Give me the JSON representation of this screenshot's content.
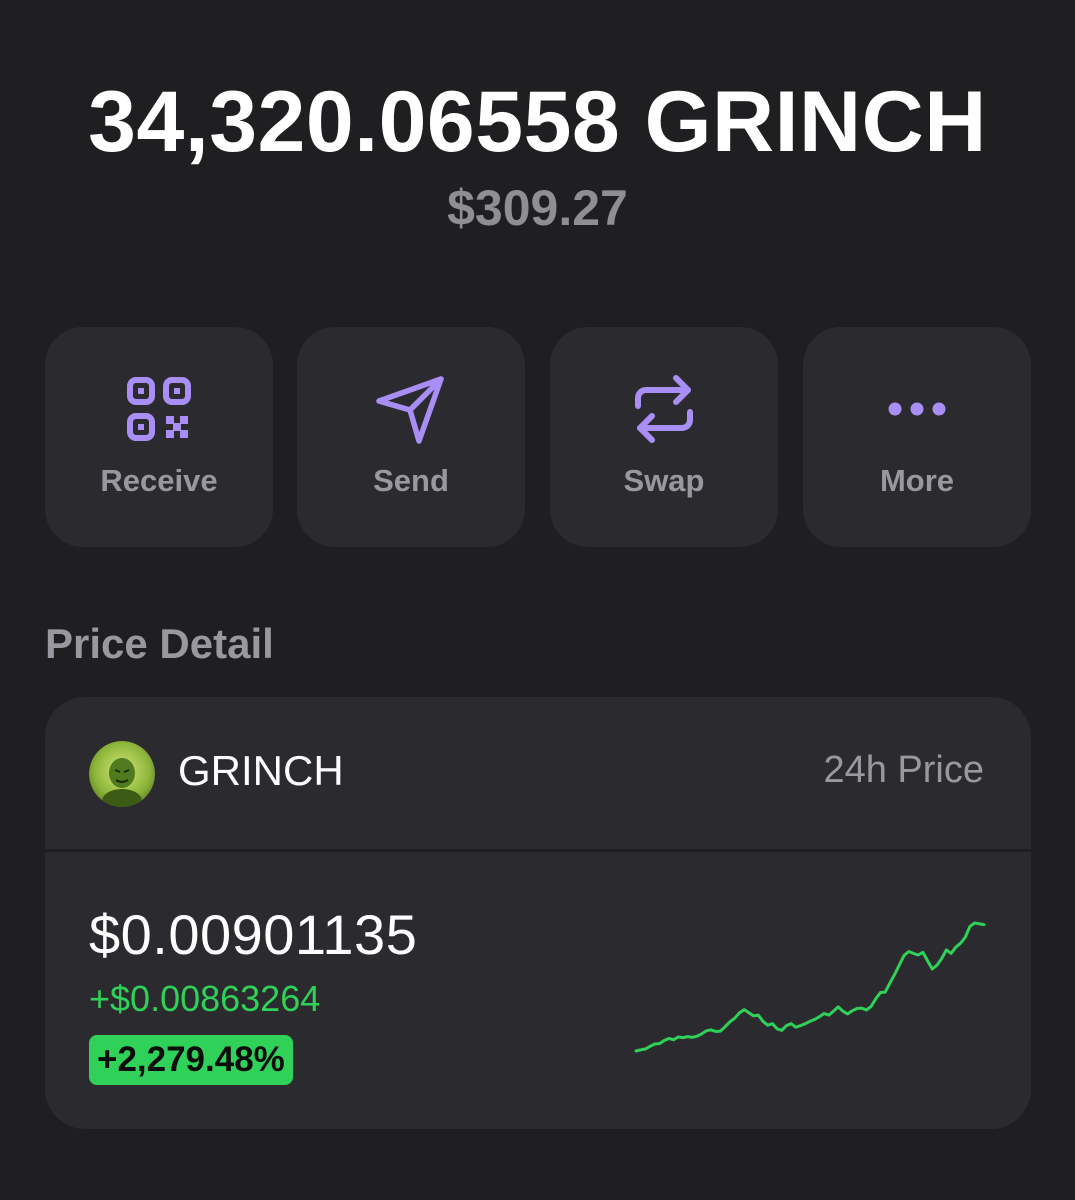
{
  "balance": {
    "amount": "34,320.06558 GRINCH",
    "fiat": "$309.27"
  },
  "actions": [
    {
      "label": "Receive",
      "icon": "qr-code-icon"
    },
    {
      "label": "Send",
      "icon": "send-arrow-icon"
    },
    {
      "label": "Swap",
      "icon": "swap-arrows-icon"
    },
    {
      "label": "More",
      "icon": "more-dots-icon"
    }
  ],
  "price_detail": {
    "section_title": "Price Detail",
    "token_name": "GRINCH",
    "period_label": "24h Price",
    "price": "$0.00901135",
    "change_abs": "+$0.00863264",
    "change_pct": "+2,279.48%"
  },
  "colors": {
    "background": "#1f1f21",
    "card": "#2b2b2f",
    "accent": "#a98ff5",
    "positive": "#30d158",
    "muted": "#98989f"
  },
  "chart_data": {
    "type": "line",
    "x": [
      0,
      1,
      2,
      3,
      4,
      5,
      6,
      7,
      8,
      9,
      10,
      11,
      12,
      13,
      14,
      15,
      16,
      17,
      18,
      19,
      20,
      21,
      22,
      23,
      24,
      25,
      26,
      27,
      28,
      29,
      30,
      31,
      32,
      33,
      34,
      35,
      36,
      37,
      38,
      39,
      40,
      41,
      42,
      43,
      44,
      45,
      46,
      47,
      48,
      49,
      50,
      51,
      52,
      53,
      54,
      55,
      56,
      57,
      58,
      59,
      60,
      61,
      62,
      63,
      64,
      65,
      66,
      67,
      68,
      69,
      70,
      71,
      72,
      73,
      74
    ],
    "values": [
      0.0,
      0.3,
      0.5,
      1.2,
      1.8,
      1.9,
      2.7,
      3.2,
      2.9,
      3.6,
      3.4,
      3.7,
      3.5,
      3.8,
      4.4,
      5.2,
      5.4,
      5.0,
      5.1,
      6.3,
      7.5,
      8.4,
      9.8,
      10.6,
      9.8,
      9.0,
      9.2,
      7.6,
      6.6,
      7.0,
      5.7,
      5.3,
      6.5,
      7.0,
      6.1,
      6.5,
      7.0,
      7.6,
      8.1,
      8.8,
      9.6,
      9.2,
      10.2,
      11.3,
      10.2,
      9.5,
      10.3,
      10.9,
      11.0,
      10.5,
      11.4,
      13.4,
      15.0,
      15.1,
      17.4,
      19.6,
      22.1,
      24.5,
      25.5,
      25.0,
      24.6,
      25.3,
      23.1,
      21.0,
      22.0,
      23.7,
      25.9,
      25.0,
      26.6,
      27.6,
      29.1,
      31.9,
      32.8,
      32.6,
      32.4
    ],
    "title": "",
    "xlabel": "",
    "ylabel": "",
    "grid": false,
    "legend": "none",
    "color": "#30d158"
  }
}
